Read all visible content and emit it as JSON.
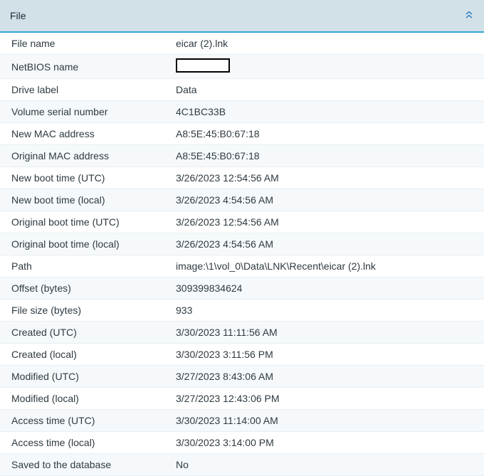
{
  "header": {
    "title": "File"
  },
  "rows": [
    {
      "label": "File name",
      "value": "eicar (2).lnk"
    },
    {
      "label": "NetBIOS name",
      "value": "",
      "redacted": true
    },
    {
      "label": "Drive label",
      "value": "Data"
    },
    {
      "label": "Volume serial number",
      "value": "4C1BC33B"
    },
    {
      "label": "New MAC address",
      "value": "A8:5E:45:B0:67:18"
    },
    {
      "label": "Original MAC address",
      "value": "A8:5E:45:B0:67:18"
    },
    {
      "label": "New boot time (UTC)",
      "value": "3/26/2023 12:54:56 AM"
    },
    {
      "label": "New boot time (local)",
      "value": "3/26/2023 4:54:56 AM"
    },
    {
      "label": "Original boot time (UTC)",
      "value": "3/26/2023 12:54:56 AM"
    },
    {
      "label": "Original boot time (local)",
      "value": "3/26/2023 4:54:56 AM"
    },
    {
      "label": "Path",
      "value": "image:\\1\\vol_0\\Data\\LNK\\Recent\\eicar (2).lnk"
    },
    {
      "label": "Offset (bytes)",
      "value": "309399834624"
    },
    {
      "label": "File size (bytes)",
      "value": "933"
    },
    {
      "label": "Created (UTC)",
      "value": "3/30/2023 11:11:56 AM"
    },
    {
      "label": "Created (local)",
      "value": "3/30/2023 3:11:56 PM"
    },
    {
      "label": "Modified (UTC)",
      "value": "3/27/2023 8:43:06 AM"
    },
    {
      "label": "Modified (local)",
      "value": "3/27/2023 12:43:06 PM"
    },
    {
      "label": "Access time (UTC)",
      "value": "3/30/2023 11:14:00 AM"
    },
    {
      "label": "Access time (local)",
      "value": "3/30/2023 3:14:00 PM"
    },
    {
      "label": "Saved to the database",
      "value": "No"
    }
  ]
}
